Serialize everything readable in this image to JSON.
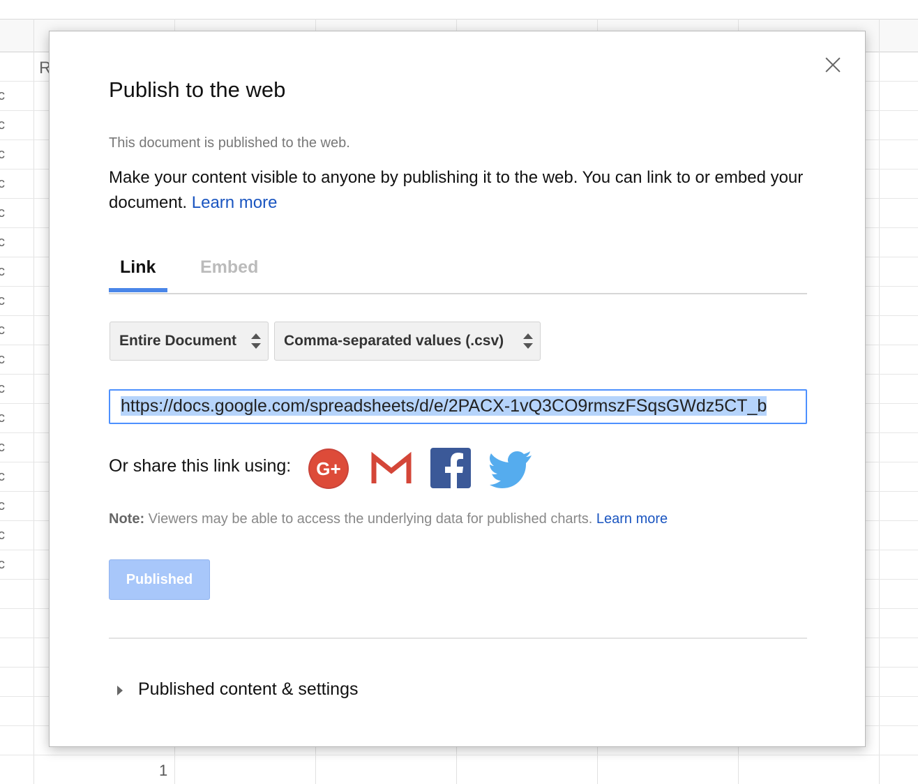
{
  "background_sheet": {
    "row_glyph": "c",
    "partial_text": "R",
    "row_number": "1"
  },
  "dialog": {
    "title": "Publish to the web",
    "status_text": "This document is published to the web.",
    "description": "Make your content visible to anyone by publishing it to the web. You can link to or embed your document.",
    "learn_more": "Learn more",
    "tabs": [
      {
        "label": "Link",
        "active": true
      },
      {
        "label": "Embed",
        "active": false
      }
    ],
    "scope_select": {
      "value": "Entire Document"
    },
    "format_select": {
      "value": "Comma-separated values (.csv)"
    },
    "url": "https://docs.google.com/spreadsheets/d/e/2PACX-1vQ3CO9rmszFSqsGWdz5CT_b",
    "share_label": "Or share this link using:",
    "share_icons": [
      "google-plus-icon",
      "gmail-icon",
      "facebook-icon",
      "twitter-icon"
    ],
    "note_label": "Note:",
    "note_text": "Viewers may be able to access the underlying data for published charts.",
    "note_learn_more": "Learn more",
    "published_button": "Published",
    "expander_label": "Published content & settings"
  },
  "colors": {
    "accent": "#4a86e8",
    "link": "#1a55c0",
    "published_button": "#a8c7fa",
    "google_plus": "#dd4b39",
    "facebook": "#3b5998",
    "twitter": "#55acee"
  }
}
